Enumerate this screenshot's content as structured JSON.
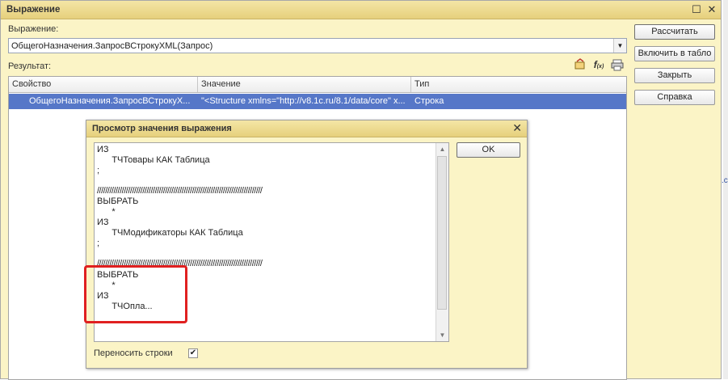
{
  "window": {
    "title": "Выражение",
    "maximize_icon": "maximize-icon",
    "close_icon": "close-icon"
  },
  "expression": {
    "label": "Выражение:",
    "value": "ОбщегоНазначения.ЗапросВСтрокуXML(Запрос)"
  },
  "result": {
    "label": "Результат:",
    "toolbar_icons": [
      "view-value-icon",
      "function-icon",
      "print-icon"
    ]
  },
  "buttons": {
    "calculate": "Рассчитать",
    "to_table": "Включить в табло",
    "close": "Закрыть",
    "help": "Справка"
  },
  "grid": {
    "columns": [
      "Свойство",
      "Значение",
      "Тип"
    ],
    "rows": [
      {
        "property": "ОбщегоНазначения.ЗапросВСтрокуХ...",
        "value": "\"<Structure xmlns=\"http://v8.1c.ru/8.1/data/core\" x...",
        "type": "Строка"
      }
    ]
  },
  "dialog": {
    "title": "Просмотр значения выражения",
    "ok": "OK",
    "wrap_label": "Переносить строки",
    "wrap_checked": true,
    "lines": [
      "ИЗ",
      "      ТЧТовары КАК Таблица",
      ";",
      "",
      "////////////////////////////////////////////////////////////////////////////////",
      "ВЫБРАТЬ",
      "      *",
      "ИЗ",
      "      ТЧМодификаторы КАК Таблица",
      ";",
      "",
      "////////////////////////////////////////////////////////////////////////////////",
      "ВЫБРАТЬ",
      "      *",
      "ИЗ",
      "      ТЧОпла..."
    ]
  },
  "colors": {
    "window_bg": "#fbf4c6",
    "selection": "#5677c8",
    "highlight": "#e02020"
  }
}
